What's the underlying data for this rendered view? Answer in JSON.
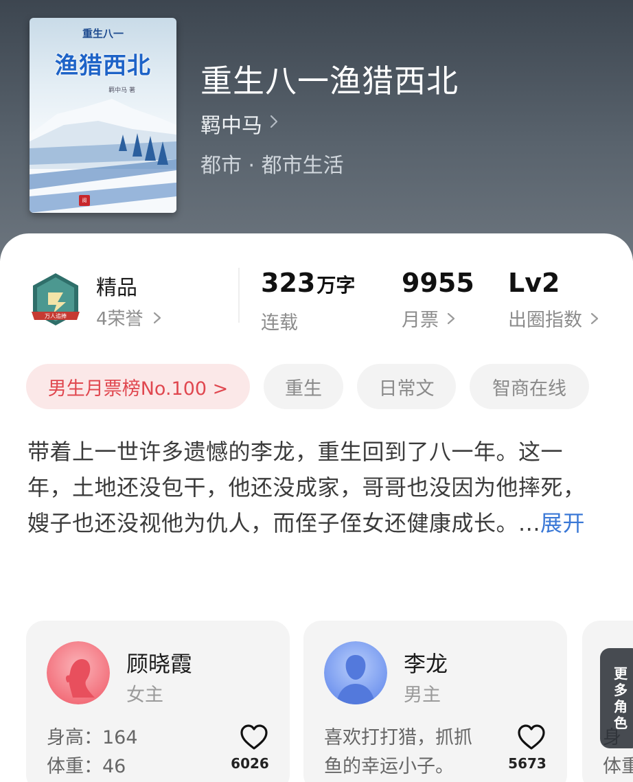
{
  "book": {
    "cover_subtitle": "重生八一",
    "cover_title": "渔猎西北",
    "cover_author": "羁中马 著",
    "title": "重生八一渔猎西北",
    "author": "羁中马",
    "genre": "都市 · 都市生活"
  },
  "honor": {
    "title": "精品",
    "count_label": "4荣誉"
  },
  "stats": {
    "words_value": "323",
    "words_unit": "万字",
    "words_label": "连载",
    "tickets_value": "9955",
    "tickets_label": "月票",
    "level_value": "Lv2",
    "level_label": "出圈指数"
  },
  "tags": [
    "男生月票榜No.100 >",
    "重生",
    "日常文",
    "智商在线"
  ],
  "synopsis": {
    "text": "带着上一世许多遗憾的李龙，重生回到了八一年。这一年，土地还没包干，他还没成家，哥哥也没因为他摔死，嫂子也还没视他为仇人，而侄子侄女还健康成长。...",
    "expand_label": "展开"
  },
  "characters": [
    {
      "name": "顾晓霞",
      "role": "女主",
      "line1": "身高：164",
      "line2": "体重：46",
      "likes": "6026"
    },
    {
      "name": "李龙",
      "role": "男主",
      "line1": "喜欢打打猎，抓抓",
      "line2": "鱼的幸运小子。",
      "likes": "5673"
    }
  ],
  "more_roles": {
    "label": "更多角色",
    "peek_line1": "身",
    "peek_line2": "体重"
  },
  "colors": {
    "rank_tag_text": "#e0474f",
    "rank_tag_bg": "#fbe8e8",
    "expand_link": "#3a78d6"
  }
}
